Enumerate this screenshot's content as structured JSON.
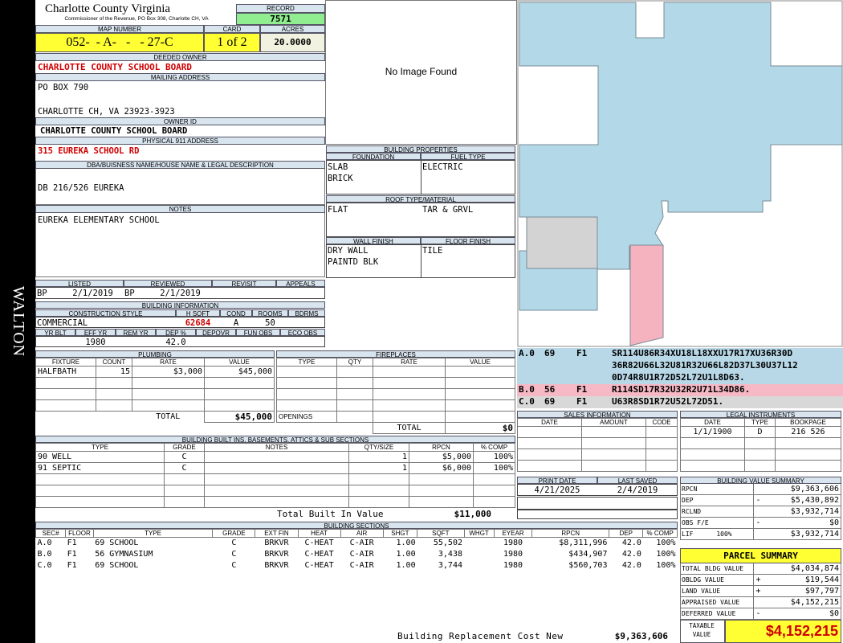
{
  "side_label": "WALTON",
  "header": {
    "county": "Charlotte County Virginia",
    "commissioner": "Commissioner of the Revenue, PO Box 308, Charlotte CH, VA",
    "record_label": "RECORD",
    "record": "7571",
    "map_label": "MAP NUMBER",
    "map_number": "052-  - A-   -   - 27-C",
    "card_label": "CARD",
    "card": "1 of 2",
    "acres_label": "ACRES",
    "acres": "20.0000"
  },
  "owner": {
    "deeded_label": "DEEDED OWNER",
    "deeded": "CHARLOTTE COUNTY SCHOOL BOARD",
    "mailing_label": "MAILING ADDRESS",
    "mail1": "PO BOX 790",
    "mail2": "CHARLOTTE CH, VA 23923-3923",
    "owner_id_label": "OWNER ID",
    "owner_id": "CHARLOTTE COUNTY SCHOOL BOARD",
    "physical_label": "PHYSICAL 911 ADDRESS",
    "physical": "315 EUREKA SCHOOL RD",
    "dba_label": "DBA/BUISNESS NAME/HOUSE NAME & LEGAL DESCRIPTION",
    "dba": "DB 216/526  EUREKA",
    "notes_label": "NOTES",
    "notes": "EUREKA ELEMENTARY SCHOOL"
  },
  "image_text": "No Image Found",
  "props": {
    "title": "BUILDING PROPERTIES",
    "foundation_label": "FOUNDATION",
    "fuel_label": "FUEL TYPE",
    "foundation1": "SLAB",
    "foundation2": "BRICK",
    "fuel": "ELECTRIC",
    "roof_label": "ROOF TYPE/MATERIAL",
    "roof1": "FLAT",
    "roof2": "TAR & GRVL",
    "wall_label": "WALL FINISH",
    "floor_label": "FLOOR FINISH",
    "wall1": "DRY WALL",
    "wall2": "PAINTD BLK",
    "floor": "TILE"
  },
  "dates": {
    "listed_label": "LISTED",
    "reviewed_label": "REVIEWED",
    "revisit_label": "REVISIT",
    "appeals_label": "APPEALS",
    "listed": "BP     2/1/2019",
    "reviewed": "BP     2/1/2019"
  },
  "bldg_info": {
    "title": "BUILDING INFORMATION",
    "style_label": "CONSTRUCTION STYLE",
    "hsqft_label": "H SQFT",
    "cond_label": "COND",
    "rooms_label": "ROOMS",
    "bdrms_label": "BDRMS",
    "style": "COMMERCIAL",
    "hsqft": "62684",
    "cond": "A",
    "rooms": "50",
    "yrblt_label": "YR BLT",
    "effyr_label": "EFF YR",
    "remyr_label": "REM YR",
    "dep_label": "DEP %",
    "depovr_label": "DEPOVR",
    "funobs_label": "FUN OBS",
    "ecoobs_label": "ECO OBS",
    "effyr": "1980",
    "dep": "42.0"
  },
  "plumbing": {
    "title": "PLUMBING",
    "headers": [
      "FIXTURE",
      "COUNT",
      "RATE",
      "VALUE"
    ],
    "rows": [
      [
        "HALFBATH",
        "15",
        "$3,000",
        "$45,000"
      ]
    ],
    "total_label": "TOTAL",
    "total": "$45,000"
  },
  "fireplaces": {
    "title": "FIREPLACES",
    "headers": [
      "TYPE",
      "QTY",
      "RATE",
      "VALUE"
    ],
    "openings": "OPENINGS",
    "total_label": "TOTAL",
    "total": "$0"
  },
  "builtins": {
    "title": "BUILDING BUILT INS, BASEMENTS, ATTICS & SUB SECTIONS",
    "headers": [
      "TYPE",
      "GRADE",
      "NOTES",
      "QTY/SIZE",
      "RPCN",
      "% COMP"
    ],
    "rows": [
      [
        "90 WELL",
        "C",
        "",
        "1",
        "$5,000",
        "100%"
      ],
      [
        "91 SEPTIC",
        "C",
        "",
        "1",
        "$6,000",
        "100%"
      ]
    ],
    "total_label": "Total Built In Value",
    "total": "$11,000"
  },
  "sections": {
    "title": "BUILDING SECTIONS",
    "headers": [
      "SEC#",
      "FLOOR",
      "TYPE",
      "GRADE",
      "EXT FIN",
      "HEAT",
      "AIR",
      "SHGT",
      "SQFT",
      "WHGT",
      "EYEAR",
      "RPCN",
      "DEP",
      "% COMP"
    ],
    "rows": [
      [
        "A.0",
        "F1",
        "69 SCHOOL",
        "C",
        "BRKVR",
        "C-HEAT",
        "C-AIR",
        "1.00",
        "55,502",
        "",
        "1980",
        "$8,311,996",
        "42.0",
        "100%"
      ],
      [
        "B.0",
        "F1",
        "56 GYMNASIUM",
        "C",
        "BRKVR",
        "C-HEAT",
        "C-AIR",
        "1.00",
        "3,438",
        "",
        "1980",
        "$434,907",
        "42.0",
        "100%"
      ],
      [
        "C.0",
        "F1",
        "69 SCHOOL",
        "C",
        "BRKVR",
        "C-HEAT",
        "C-AIR",
        "1.00",
        "3,744",
        "",
        "1980",
        "$560,703",
        "42.0",
        "100%"
      ]
    ],
    "brcn_label": "Building Replacement Cost New",
    "brcn": "$9,363,606"
  },
  "sketch_codes": [
    {
      "sec": "A.0",
      "num": "69",
      "fl": "F1",
      "code": "SR114U86R34XU18L18XXU17R17XU36R30D",
      "color": "#b8d8e8"
    },
    {
      "sec": "",
      "num": "",
      "fl": "",
      "code": "36R82U66L32U81R32U66L82D37L30U37L12",
      "color": "#b8d8e8"
    },
    {
      "sec": "",
      "num": "",
      "fl": "",
      "code": "0D74R8U1R72D52L72U1L8D63.",
      "color": "#b8d8e8"
    },
    {
      "sec": "B.0",
      "num": "56",
      "fl": "F1",
      "code": "R114SD17R32U32R2U71L34D86.",
      "color": "#f6b8c4"
    },
    {
      "sec": "C.0",
      "num": "69",
      "fl": "F1",
      "code": "U63R8SD1R72U52L72D51.",
      "color": "#d8d8d8"
    }
  ],
  "sales": {
    "title": "SALES INFORMATION",
    "headers": [
      "DATE",
      "AMOUNT",
      "CODE"
    ]
  },
  "legal": {
    "title": "LEGAL INSTRUMENTS",
    "headers": [
      "DATE",
      "TYPE",
      "BOOKPAGE"
    ],
    "rows": [
      [
        "1/1/1900",
        "D",
        "216 526"
      ]
    ]
  },
  "print": {
    "print_label": "PRINT DATE",
    "saved_label": "LAST SAVED",
    "print_date": "4/21/2025",
    "saved": "2/4/2019"
  },
  "value_summary": {
    "title": "BUILDING VALUE SUMMARY",
    "rows": [
      [
        "RPCN",
        "",
        "$9,363,606"
      ],
      [
        "DEP",
        "-",
        "$5,430,892"
      ],
      [
        "RCLND",
        "",
        "$3,932,714"
      ],
      [
        "OBS F/E",
        "-",
        "$0"
      ],
      [
        "LIF      100%",
        "",
        "$3,932,714"
      ]
    ]
  },
  "parcel": {
    "title": "PARCEL SUMMARY",
    "rows": [
      [
        "TOTAL BLDG VALUE",
        "",
        "$4,034,874"
      ],
      [
        "OBLDG VALUE",
        "+",
        "$19,544"
      ],
      [
        "LAND VALUE",
        "+",
        "$97,797"
      ],
      [
        "APPRAISED VALUE",
        "",
        "$4,152,215"
      ],
      [
        "DEFERRED VALUE",
        "-",
        "$0"
      ]
    ],
    "taxable_label1": "TAXABLE",
    "taxable_label2": "VALUE",
    "taxable": "$4,152,215"
  },
  "colors": {
    "section_a": "#b3d9e8",
    "section_b": "#f5b3bf",
    "section_c": "#d3d3d3",
    "accent_yellow": "#ffff33",
    "record_green": "#90ee90"
  }
}
